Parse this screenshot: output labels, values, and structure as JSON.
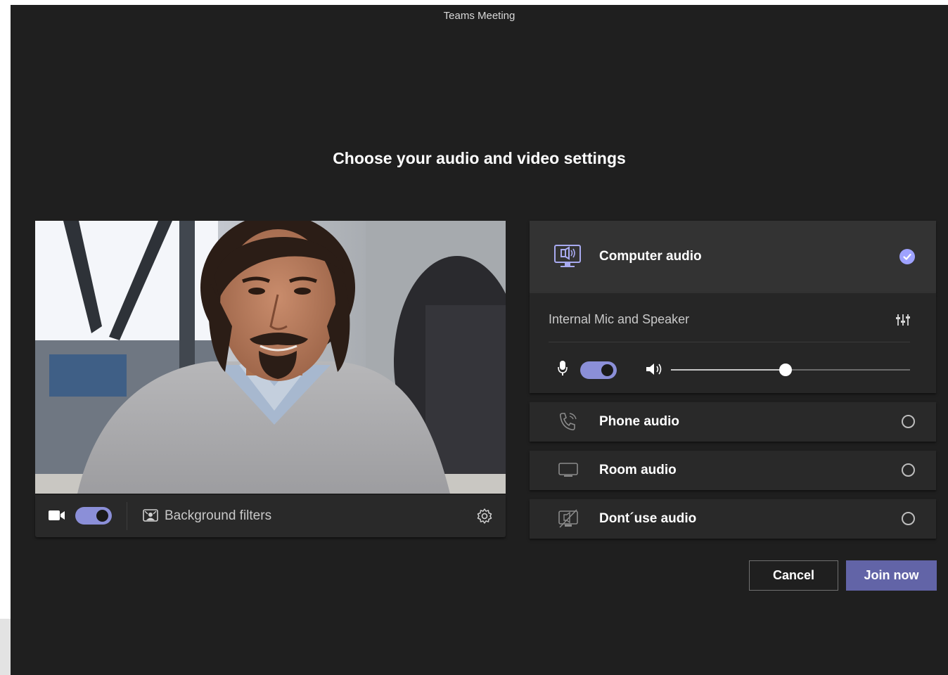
{
  "window": {
    "title": "Teams Meeting"
  },
  "heading": "Choose your audio and video settings",
  "video_bar": {
    "camera_icon": "video-camera-icon",
    "camera_on": true,
    "background_filters_label": "Background filters",
    "settings_icon": "gear-icon"
  },
  "audio": {
    "computer": {
      "label": "Computer audio",
      "icon": "monitor-speaker-icon",
      "selected": true
    },
    "device": {
      "label": "Internal Mic and Speaker",
      "settings_icon": "sliders-icon"
    },
    "mic_on": true,
    "speaker_volume": 0.48,
    "phone": {
      "label": "Phone audio",
      "icon": "phone-icon",
      "selected": false
    },
    "room": {
      "label": "Room audio",
      "icon": "room-display-icon",
      "selected": false
    },
    "none": {
      "label": "Dont´use audio",
      "icon": "no-audio-icon",
      "selected": false
    }
  },
  "actions": {
    "cancel": "Cancel",
    "join": "Join now"
  },
  "colors": {
    "accent": "#6264a7",
    "toggle": "#8b8fd8",
    "check": "#9ea2ff",
    "panel": "#292929",
    "background": "#1f1f1f"
  }
}
